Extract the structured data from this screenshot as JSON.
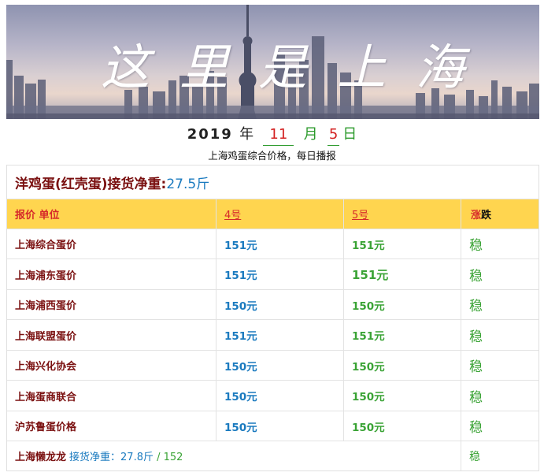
{
  "banner": {
    "title": "这里是上海"
  },
  "date": {
    "year": "2019",
    "year_char": "年",
    "month": "11",
    "month_char": "月",
    "day": "5",
    "day_char": "日"
  },
  "subtitle": "上海鸡蛋综合价格，每日播报",
  "table": {
    "title_label": "洋鸡蛋(红壳蛋)接货净重:",
    "title_value": "27.5斤",
    "header": {
      "col1": "报价 单位",
      "col2": "4号",
      "col3": "5号",
      "col4a": "涨",
      "col4b": "跌"
    },
    "rows": [
      {
        "name": "上海综合蛋价",
        "d4": "151元",
        "d5": "151元",
        "trend": "稳"
      },
      {
        "name": "上海浦东蛋价",
        "d4": "151元",
        "d5": "151元",
        "trend": "稳"
      },
      {
        "name": "上海浦西蛋价",
        "d4": "150元",
        "d5": "150元",
        "trend": "稳"
      },
      {
        "name": "上海联盟蛋价",
        "d4": "151元",
        "d5": "151元",
        "trend": "稳"
      },
      {
        "name": "上海兴化协会",
        "d4": "150元",
        "d5": "150元",
        "trend": "稳"
      },
      {
        "name": "上海蛋商联合",
        "d4": "150元",
        "d5": "150元",
        "trend": "稳"
      },
      {
        "name": "沪苏鲁蛋价格",
        "d4": "150元",
        "d5": "150元",
        "trend": "稳"
      }
    ],
    "footer": {
      "name": "上海懒龙龙",
      "label": "接货净重：",
      "value": "27.8斤",
      "sep": " / ",
      "price": "152",
      "trend": "稳"
    }
  }
}
